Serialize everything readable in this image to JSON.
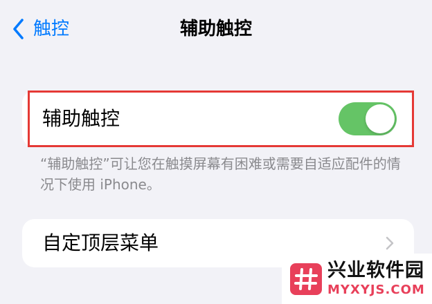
{
  "nav": {
    "back_label": "触控",
    "title": "辅助触控"
  },
  "toggle_row": {
    "label": "辅助触控",
    "toggle_state": "on",
    "footer": "“辅助触控”可让您在触摸屏幕有困难或需要自适应配件的情况下使用 iPhone。"
  },
  "menu_row": {
    "label": "自定顶层菜单"
  },
  "watermark": {
    "name_cn": "兴业软件园",
    "name_en": "MYXYJS.COM"
  },
  "colors": {
    "accent": "#007aff",
    "toggle_on": "#65c466",
    "highlight": "#e53935",
    "background": "#f2f2f7",
    "watermark": "#e8405a"
  },
  "icons": {
    "back": "chevron-left-icon",
    "disclosure": "chevron-right-icon",
    "logo": "hash-logo-icon"
  }
}
